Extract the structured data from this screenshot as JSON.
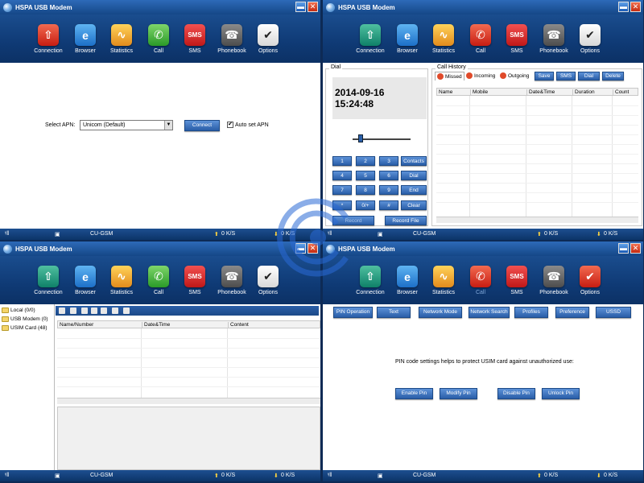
{
  "app_title": "HSPA USB Modem",
  "win": {
    "minimize": "▬",
    "close": "✕"
  },
  "toolbar_items": [
    {
      "label": "Connection",
      "icon": "connection-icon",
      "glyph": "⇧"
    },
    {
      "label": "Browser",
      "icon": "browser-icon",
      "glyph": "e"
    },
    {
      "label": "Statistics",
      "icon": "statistics-icon",
      "glyph": "∿"
    },
    {
      "label": "Call",
      "icon": "phone-icon",
      "glyph": "✆"
    },
    {
      "label": "SMS",
      "icon": "sms-icon",
      "glyph": "SMS"
    },
    {
      "label": "Phonebook",
      "icon": "phonebook-icon",
      "glyph": "☎"
    },
    {
      "label": "Options",
      "icon": "options-icon",
      "glyph": "✔"
    }
  ],
  "status": {
    "operator": "CU-GSM",
    "upload": "0 K/S",
    "download": "0 K/S",
    "signal": "signal-icon",
    "sim": "sim-icon"
  },
  "connection": {
    "apn_label": "Select APN:",
    "apn_value": "Unicom (Default)",
    "connect_label": "Connect",
    "auto_apn_label": "Auto set APN",
    "auto_apn_checked": "✔"
  },
  "call": {
    "dial_title": "Dial",
    "datetime": "2014-09-16  15:24:48",
    "keypad": [
      [
        "1",
        "2",
        "3",
        "Contacts"
      ],
      [
        "4",
        "5",
        "6",
        "Dial"
      ],
      [
        "7",
        "8",
        "9",
        "End"
      ],
      [
        "*",
        "0/+",
        "#",
        "Clear"
      ]
    ],
    "record_label": "Record",
    "record_file_label": "Record File",
    "history_title": "Call History",
    "tabs": [
      "Missed",
      "Incoming",
      "Outgoing"
    ],
    "actions": [
      "Save",
      "SMS",
      "Dial",
      "Delete"
    ],
    "columns": [
      "Name",
      "Mobile",
      "Date&Time",
      "Duration",
      "Count"
    ]
  },
  "phonebook": {
    "tree": [
      "Local (0/0)",
      "USB Modem (0)",
      "USIM Card (48)"
    ],
    "columns": [
      "Name/Number",
      "Date&Time",
      "Content"
    ]
  },
  "options": {
    "tabs": [
      "PIN Operation",
      "Text",
      "Network Mode",
      "Network Search",
      "Profiles",
      "Preference",
      "USSD"
    ],
    "pin_text": "PIN code settings helps to protect USIM card against unauthorized use:",
    "pin_buttons": [
      "Enable Pin",
      "Modify Pin",
      "Disable Pin",
      "Unlock Pin"
    ]
  }
}
